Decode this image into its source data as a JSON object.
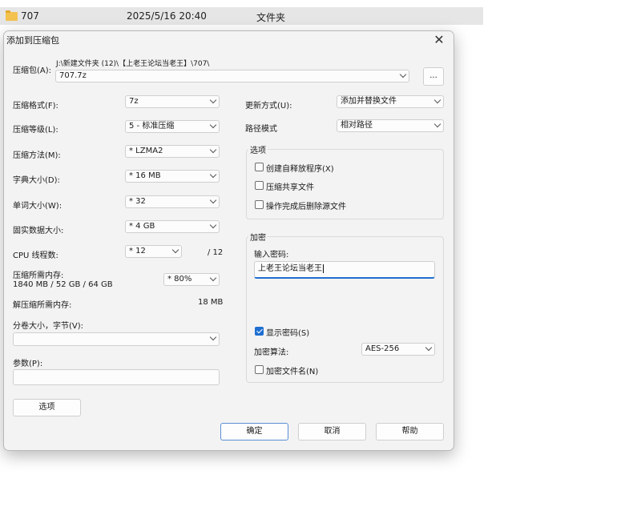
{
  "filelist": {
    "name": "707",
    "date": "2025/5/16 20:40",
    "type": "文件夹"
  },
  "dialog": {
    "title": "添加到压缩包",
    "archive_label": "压缩包(A):",
    "archive_path": "J:\\新建文件夹 (12)\\【上老王论坛当老王】\\707\\",
    "archive_name": "707.7z",
    "browse_label": "...",
    "left": {
      "format_label": "压缩格式(F):",
      "format_value": "7z",
      "level_label": "压缩等级(L):",
      "level_value": "5 - 标准压缩",
      "method_label": "压缩方法(M):",
      "method_value": "* LZMA2",
      "dict_label": "字典大小(D):",
      "dict_value": "* 16 MB",
      "word_label": "单词大小(W):",
      "word_value": "* 32",
      "solid_label": "固实数据大小:",
      "solid_value": "* 4 GB",
      "cpu_label": "CPU 线程数:",
      "cpu_value": "* 12",
      "cpu_max": "/ 12",
      "mem_label": "压缩所需内存:",
      "mem_value": "1840 MB / 52 GB / 64 GB",
      "mem_percent": "* 80%",
      "decomp_label": "解压缩所需内存:",
      "decomp_value": "18 MB",
      "split_label": "分卷大小，字节(V):",
      "params_label": "参数(P):",
      "options_button": "选项"
    },
    "right": {
      "update_label": "更新方式(U):",
      "update_value": "添加并替换文件",
      "path_label": "路径模式",
      "path_value": "相对路径",
      "options_group": "选项",
      "opt_sfx": "创建自释放程序(X)",
      "opt_shared": "压缩共享文件",
      "opt_delete": "操作完成后删除源文件",
      "encrypt_group": "加密",
      "pwd_label": "输入密码:",
      "pwd_value": "上老王论坛当老王",
      "show_pwd": "显示密码(S)",
      "algo_label": "加密算法:",
      "algo_value": "AES-256",
      "encrypt_names": "加密文件名(N)"
    },
    "buttons": {
      "ok": "确定",
      "cancel": "取消",
      "help": "帮助"
    }
  },
  "colors": {
    "accent": "#1f6fd1",
    "dialog_bg": "#f3f3f3",
    "row_highlight": "#e6e6e6"
  }
}
